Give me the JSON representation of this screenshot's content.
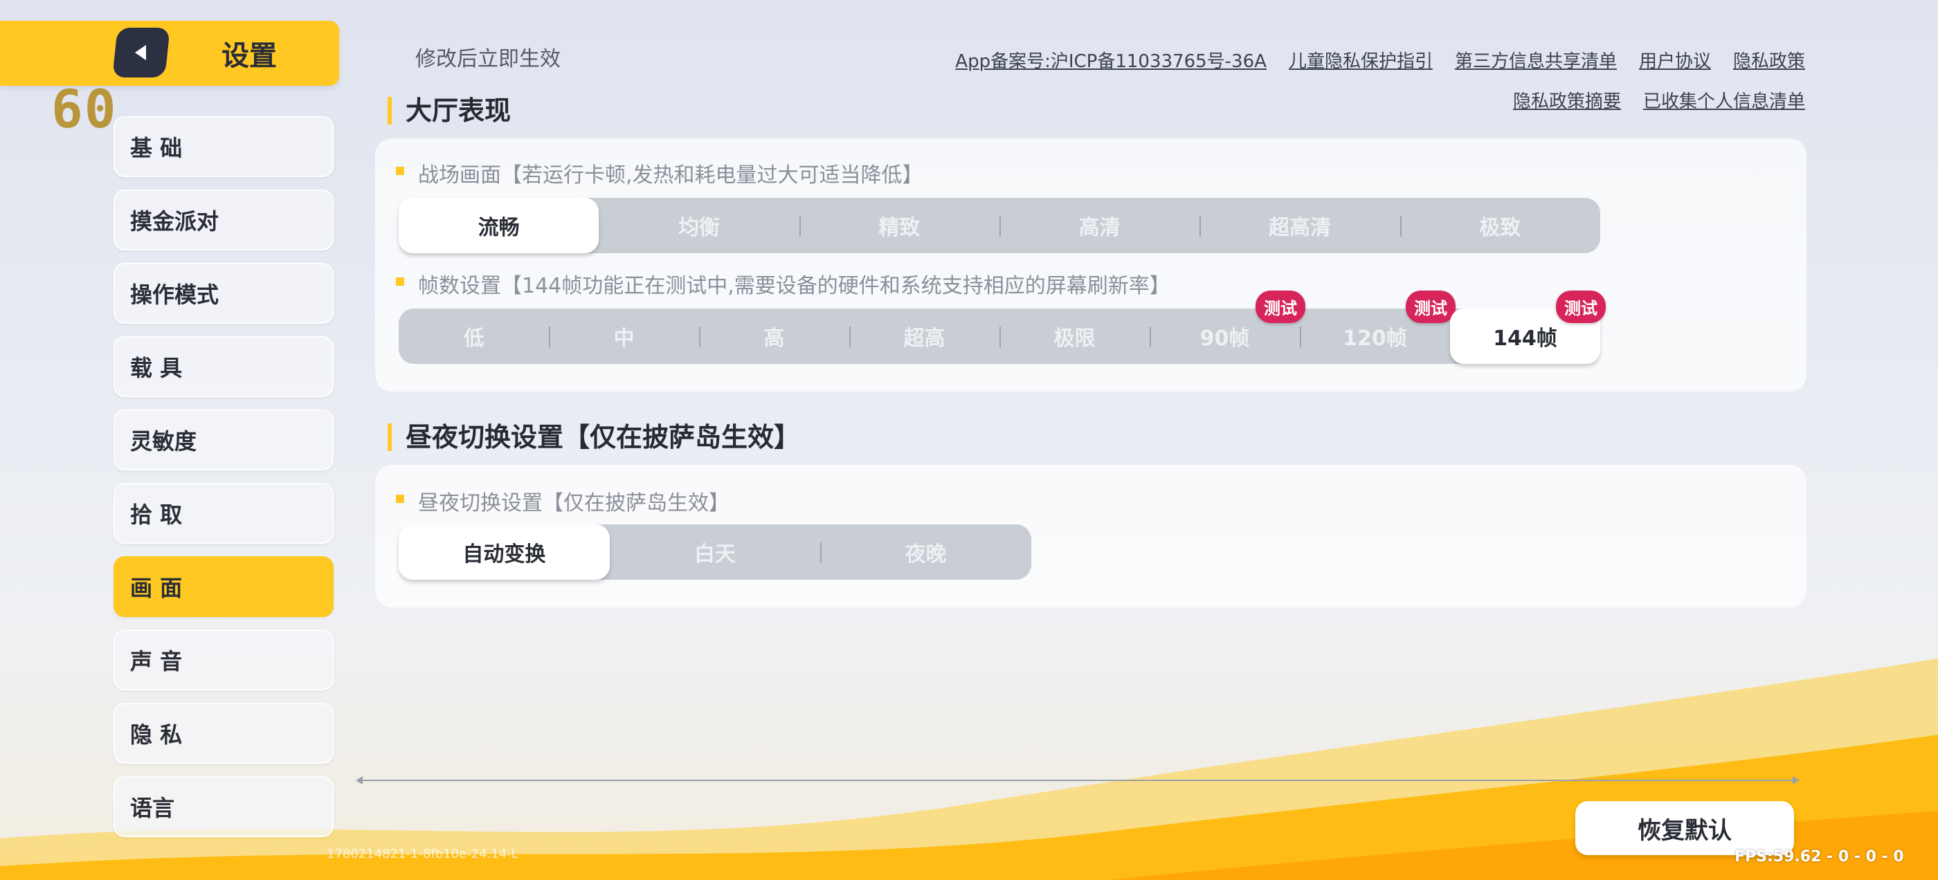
{
  "header": {
    "title": "设置",
    "fps_overlay": "60"
  },
  "sidebar": {
    "items": [
      {
        "label": "基 础"
      },
      {
        "label": "摸金派对"
      },
      {
        "label": "操作模式"
      },
      {
        "label": "载 具"
      },
      {
        "label": "灵敏度"
      },
      {
        "label": "拾 取"
      },
      {
        "label": "画 面"
      },
      {
        "label": "声 音"
      },
      {
        "label": "隐 私"
      },
      {
        "label": "语言"
      }
    ],
    "active_index": 6
  },
  "top": {
    "hint": "修改后立即生效",
    "links_row1": [
      "App备案号:沪ICP备11033765号-36A",
      "儿童隐私保护指引",
      "第三方信息共享清单",
      "用户协议",
      "隐私政策"
    ],
    "links_row2": [
      "隐私政策摘要",
      "已收集个人信息清单"
    ]
  },
  "lobby": {
    "section_title": "大厅表现",
    "graphics": {
      "label": "战场画面【若运行卡顿,发热和耗电量过大可适当降低】",
      "options": [
        "流畅",
        "均衡",
        "精致",
        "高清",
        "超高清",
        "极致"
      ],
      "selected": "流畅"
    },
    "framerate": {
      "label": "帧数设置【144帧功能正在测试中,需要设备的硬件和系统支持相应的屏幕刷新率】",
      "options": [
        "低",
        "中",
        "高",
        "超高",
        "极限",
        "90帧",
        "120帧",
        "144帧"
      ],
      "selected": "144帧",
      "badge": "测试"
    }
  },
  "daynight": {
    "section_title": "昼夜切换设置【仅在披萨岛生效】",
    "label": "昼夜切换设置【仅在披萨岛生效】",
    "options": [
      "自动变换",
      "白天",
      "夜晚"
    ],
    "selected": "自动变换"
  },
  "footer": {
    "reset_label": "恢复默认",
    "version": "1780214821-1-8fb10e-24.14-L",
    "fps_small": "FPS:59.62 - 0 - 0 - 0"
  },
  "colors": {
    "accent": "#ffc823",
    "badge": "#d7245a",
    "segment_bg": "#c9cdd4"
  },
  "icons": {
    "back": "back-arrow-icon"
  }
}
